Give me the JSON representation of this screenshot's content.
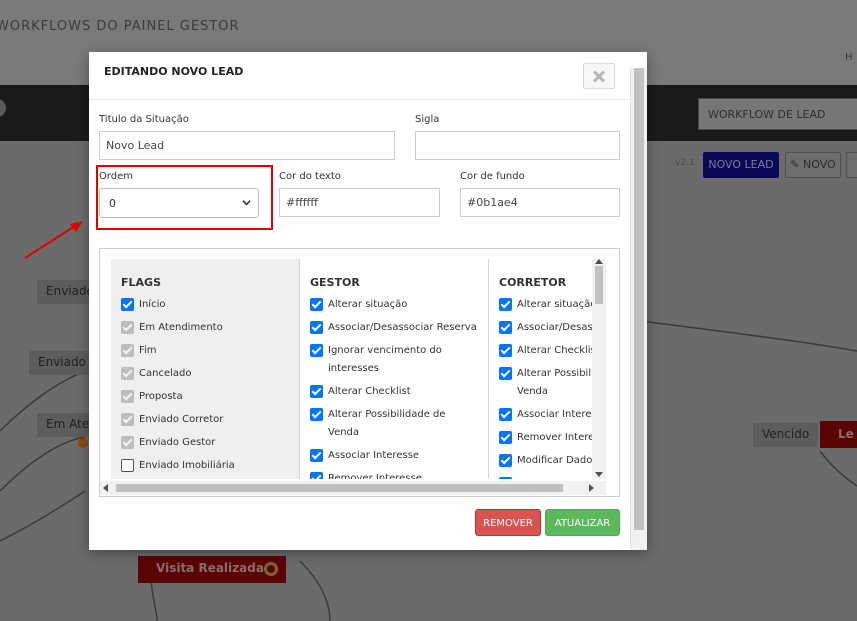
{
  "background": {
    "title": "WORKFLOWS DO PAINEL GESTOR",
    "top_right_text": "H",
    "workflow_select_value": "WORKFLOW DE LEAD",
    "version_text": "v2.1",
    "btn_novo_lead": "NOVO LEAD",
    "btn_novo": "NOVO",
    "nodes": {
      "enviado_1": "Enviado",
      "enviado_2": "Enviado",
      "em_atendimento": "Em Ate",
      "vencido": "Vencido",
      "lead_partial": "Le",
      "visita_realizada": "Visita Realizada"
    }
  },
  "modal": {
    "title": "EDITANDO NOVO LEAD",
    "fields": {
      "titulo_label": "Titulo da Situação",
      "titulo_value": "Novo Lead",
      "sigla_label": "Sigla",
      "sigla_value": "",
      "ordem_label": "Ordem",
      "ordem_value": "0",
      "cor_texto_label": "Cor do texto",
      "cor_texto_value": "#ffffff",
      "cor_fundo_label": "Cor de fundo",
      "cor_fundo_value": "#0b1ae4"
    },
    "flags": {
      "header": "FLAGS",
      "items": [
        {
          "label": "Início",
          "state": "checked"
        },
        {
          "label": "Em Atendimento",
          "state": "disabled"
        },
        {
          "label": "Fim",
          "state": "disabled"
        },
        {
          "label": "Cancelado",
          "state": "disabled"
        },
        {
          "label": "Proposta",
          "state": "disabled"
        },
        {
          "label": "Enviado Corretor",
          "state": "disabled"
        },
        {
          "label": "Enviado Gestor",
          "state": "disabled"
        },
        {
          "label": "Enviado Imobiliária",
          "state": "unchecked"
        }
      ]
    },
    "gestor": {
      "header": "GESTOR",
      "items": [
        {
          "label": "Alterar situação"
        },
        {
          "label": "Associar/Desassociar Reserva"
        },
        {
          "label": "Ignorar vencimento do interesses"
        },
        {
          "label": "Alterar Checklist"
        },
        {
          "label": "Alterar Possibilidade de Venda"
        },
        {
          "label": "Associar Interesse"
        },
        {
          "label": "Remover Interesse"
        }
      ]
    },
    "corretor": {
      "header": "CORRETOR",
      "items": [
        {
          "label": "Alterar situação"
        },
        {
          "label": "Associar/Desassociar Reserva"
        },
        {
          "label": "Alterar Checklist"
        },
        {
          "label": "Alterar Possibilidade de Venda"
        },
        {
          "label": "Associar Interesse"
        },
        {
          "label": "Remover Interesse"
        },
        {
          "label": "Modificar Dados"
        }
      ]
    },
    "buttons": {
      "remover": "REMOVER",
      "atualizar": "ATUALIZAR"
    }
  },
  "colors": {
    "highlight": "#e00000",
    "checkbox_checked": "#0075ff",
    "remover": "#d9534f",
    "atualizar": "#5cb85c",
    "novo_lead_btn": "#0b0856"
  }
}
